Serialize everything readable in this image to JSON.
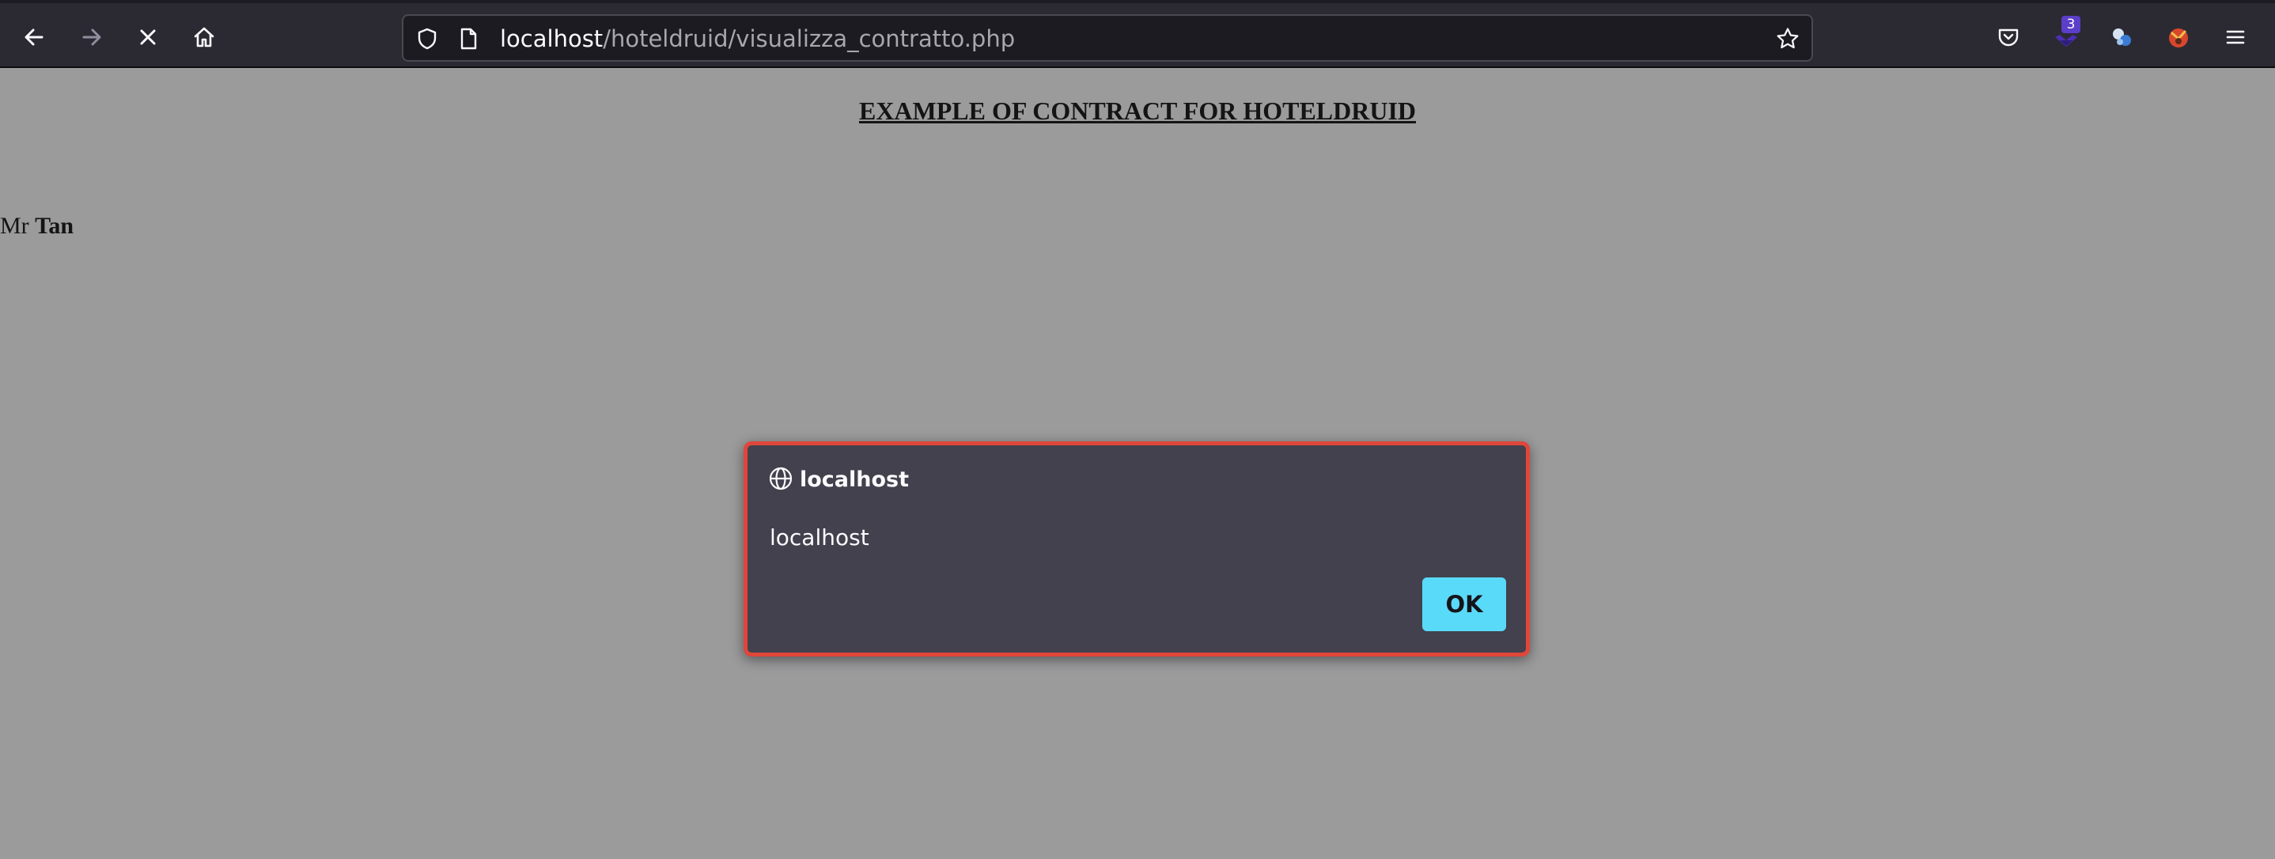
{
  "browser": {
    "url": {
      "host": "localhost",
      "path": "/hoteldruid/visualizza_contratto.php"
    },
    "toolbar_icons": [
      "back-arrow-icon",
      "forward-arrow-icon",
      "stop-loading-icon",
      "home-icon",
      "shield-icon",
      "page-icon",
      "bookmark-star-icon",
      "pocket-icon",
      "extension-icon",
      "extension-icon",
      "extension-icon",
      "menu-icon"
    ],
    "extension_badge": "3"
  },
  "page": {
    "title": "EXAMPLE OF CONTRACT FOR HOTELDRUID",
    "greeting": {
      "prefix": "Mr",
      "name": "Tan"
    }
  },
  "dialog": {
    "title": "localhost",
    "message": "localhost",
    "ok_label": "OK",
    "icon": "globe-icon"
  },
  "colors": {
    "toolbar_bg": "#2b2a33",
    "urlbar_bg": "#1c1b22",
    "page_bg": "#9b9b9c",
    "dialog_bg": "#42414d",
    "dialog_border": "#e0463a",
    "ok_button": "#5adaf9"
  }
}
